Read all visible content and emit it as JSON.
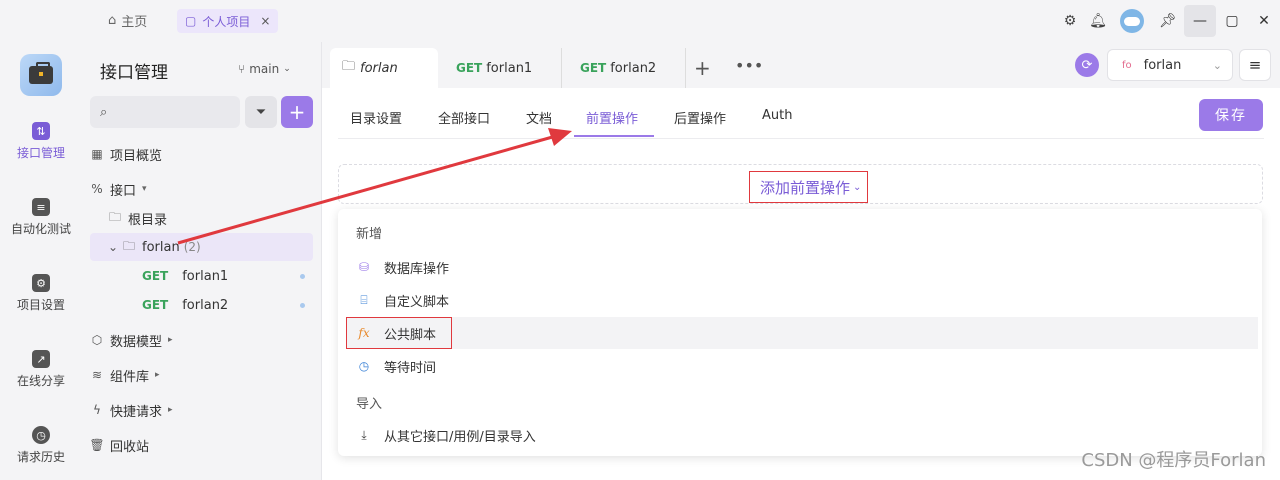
{
  "titlebar": {
    "home_label": "主页",
    "project_tab": "个人项目",
    "close_glyph": "×"
  },
  "rail": {
    "items": [
      {
        "label": "接口管理",
        "icon": "api-icon"
      },
      {
        "label": "自动化测试",
        "icon": "automation-icon"
      },
      {
        "label": "项目设置",
        "icon": "settings-icon"
      },
      {
        "label": "在线分享",
        "icon": "share-icon"
      },
      {
        "label": "请求历史",
        "icon": "history-icon"
      }
    ]
  },
  "sidebar": {
    "title": "接口管理",
    "branch": "main",
    "tree": {
      "overview": "项目概览",
      "api": "接口",
      "root": "根目录",
      "folder": "forlan",
      "folder_count": "(2)",
      "endpoints": [
        {
          "method": "GET",
          "name": "forlan1"
        },
        {
          "method": "GET",
          "name": "forlan2"
        }
      ],
      "data_models": "数据模型",
      "components": "组件库",
      "quick_requests": "快捷请求",
      "trash": "回收站"
    }
  },
  "main": {
    "tabs": [
      {
        "label": "forlan",
        "method": ""
      },
      {
        "label": "forlan1",
        "method": "GET"
      },
      {
        "label": "forlan2",
        "method": "GET"
      }
    ],
    "env": {
      "badge": "fo",
      "name": "forlan"
    },
    "subtabs": [
      "目录设置",
      "全部接口",
      "文档",
      "前置操作",
      "后置操作",
      "Auth"
    ],
    "save_label": "保存",
    "add_pre_label": "添加前置操作",
    "dropdown": {
      "group_new": "新增",
      "items": [
        {
          "label": "数据库操作",
          "icon": "database-icon"
        },
        {
          "label": "自定义脚本",
          "icon": "script-icon"
        },
        {
          "label": "公共脚本",
          "icon": "fx-icon"
        },
        {
          "label": "等待时间",
          "icon": "clock-icon"
        }
      ],
      "group_import": "导入",
      "import_item": "从其它接口/用例/目录导入"
    }
  },
  "watermark": "CSDN @程序员Forlan",
  "colors": {
    "accent": "#9b7ae8",
    "get": "#3aa35c",
    "annotation": "#e0393e"
  }
}
